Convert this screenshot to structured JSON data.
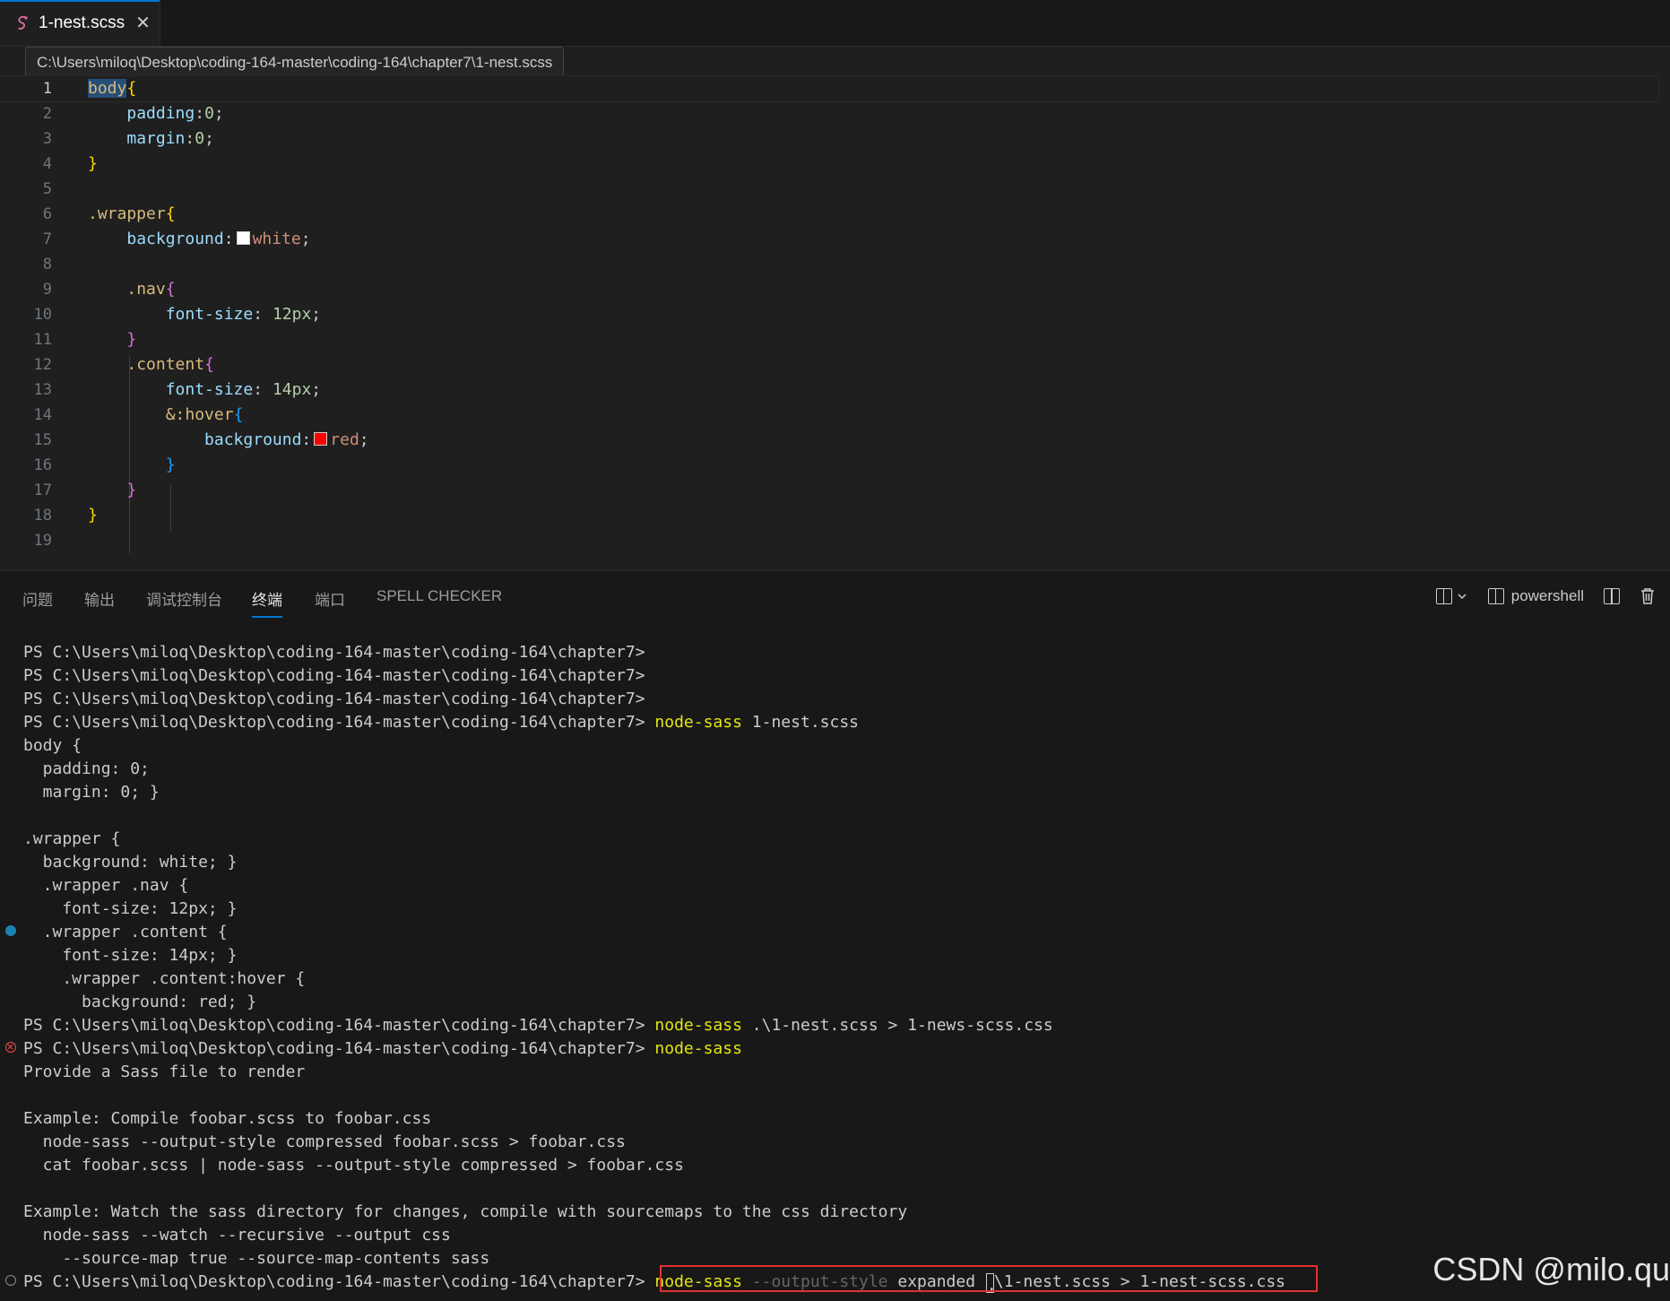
{
  "tab": {
    "label": "1-nest.scss",
    "close": "✕"
  },
  "breadcrumb": {
    "path": "C:\\Users\\miloq\\Desktop\\coding-164-master\\coding-164\\chapter7\\1-nest.scss"
  },
  "editor": {
    "line_numbers": [
      "1",
      "2",
      "3",
      "4",
      "5",
      "6",
      "7",
      "8",
      "9",
      "10",
      "11",
      "12",
      "13",
      "14",
      "15",
      "16",
      "17",
      "18",
      "19"
    ],
    "tokens": {
      "l1_sel": "body",
      "l1_brace": "{",
      "l2": "padding",
      "l2_val": "0",
      "l3": "margin",
      "l3_val": "0",
      "l4_brace": "}",
      "l6_sel": ".wrapper",
      "l6_brace": "{",
      "l7": "background",
      "l7_val": "white",
      "l9_sel": ".nav",
      "l9_brace": "{",
      "l10": "font-size",
      "l10_val": "12px",
      "l11_brace": "}",
      "l12_sel": ".content",
      "l12_brace": "{",
      "l13": "font-size",
      "l13_val": "14px",
      "l14_sel": "&:hover",
      "l14_brace": "{",
      "l15": "background",
      "l15_val": "red",
      "l16_brace": "}",
      "l17_brace": "}",
      "l18_brace": "}"
    },
    "swatch_colors": {
      "white": "#ffffff",
      "red": "#ff0000"
    }
  },
  "panel": {
    "tabs": [
      "问题",
      "输出",
      "调试控制台",
      "终端",
      "端口",
      "SPELL CHECKER"
    ],
    "active_tab": "终端",
    "shell": "powershell"
  },
  "terminal": {
    "prompt": "PS C:\\Users\\miloq\\Desktop\\coding-164-master\\coding-164\\chapter7>",
    "cmd_name": "node-sass",
    "l4_args": "1-nest.scss",
    "output1": [
      "body {",
      "  padding: 0;",
      "  margin: 0; }",
      "",
      ".wrapper {",
      "  background: white; }",
      "  .wrapper .nav {",
      "    font-size: 12px; }",
      "  .wrapper .content {",
      "    font-size: 14px; }",
      "    .wrapper .content:hover {",
      "      background: red; }"
    ],
    "l17_args": ".\\1-nest.scss > 1-news-scss.css",
    "output2": [
      "Provide a Sass file to render",
      "",
      "Example: Compile foobar.scss to foobar.css",
      "  node-sass --output-style compressed foobar.scss > foobar.css",
      "  cat foobar.scss | node-sass --output-style compressed > foobar.css",
      "",
      "Example: Watch the sass directory for changes, compile with sourcemaps to the css directory",
      "  node-sass --watch --recursive --output css",
      "    --source-map true --source-map-contents sass"
    ],
    "last_flag": "--output-style",
    "last_value": "expanded",
    "last_before_cursor": ".",
    "last_after_cursor": "\\1-nest.scss > 1-nest-scss.css"
  },
  "watermark": "CSDN @milo.qu"
}
